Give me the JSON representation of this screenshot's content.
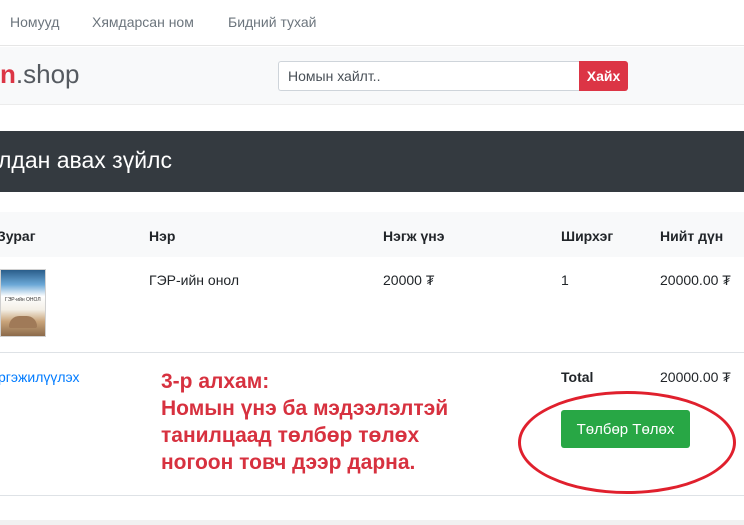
{
  "nav": {
    "items": [
      "Номууд",
      "Хямдарсан ном",
      "Бидний тухай"
    ]
  },
  "header": {
    "logo_accent": "n",
    "logo_text": ".shop",
    "search_placeholder": "Номын хайлт..",
    "search_button": "Хайх"
  },
  "page": {
    "title": "лдан авах зүйлс"
  },
  "table": {
    "headers": [
      "Зураг",
      "Нэр",
      "Нэгж үнэ",
      "Ширхэг",
      "Нийт дүн"
    ],
    "rows": [
      {
        "image_alt": "ГЭР-ийн ОНОЛ",
        "name": "ГЭР-ийн онол",
        "unit_price": "20000 ₮",
        "quantity": "1",
        "total": "20000.00 ₮"
      }
    ]
  },
  "summary": {
    "continue_link": "ргэжилүүлэх",
    "total_label": "Total",
    "total_value": "20000.00 ₮",
    "pay_button": "Төлбөр Төлөх"
  },
  "annotation": {
    "lines": [
      "3-р алхам:",
      "Номын үнэ ба мэдээлэлтэй",
      "танилцаад төлбөр төлөх",
      "ногоон товч дээр дарна."
    ]
  },
  "colors": {
    "accent_red": "#dc3545",
    "pay_green": "#28a745",
    "dark_bar": "#343a40",
    "link_blue": "#007bff",
    "annotation_red": "#d7313f"
  }
}
